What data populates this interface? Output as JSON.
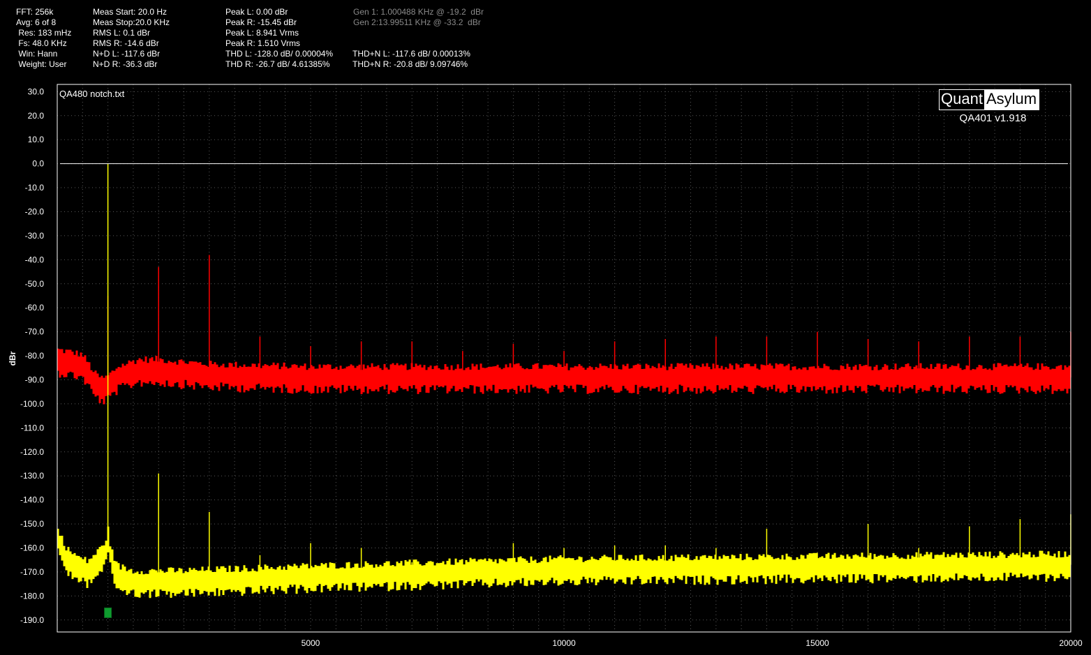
{
  "stats": {
    "col1": [
      "FFT: 256k",
      "Avg: 6 of 8",
      " Res: 183 mHz",
      " Fs: 48.0 KHz",
      " Win: Hann",
      " Weight: User"
    ],
    "col2": [
      "Meas Start: 20.0 Hz",
      "Meas Stop:20.0 KHz",
      "RMS L: 0.1 dBr",
      "RMS R: -14.6 dBr",
      "N+D L: -117.6 dBr",
      "N+D R: -36.3 dBr"
    ],
    "col3": [
      "Peak L: 0.00 dBr",
      "Peak R: -15.45 dBr",
      "Peak L: 8.941 Vrms",
      "Peak R: 1.510 Vrms",
      "THD L: -128.0 dB/ 0.00004%",
      "THD R: -26.7 dB/ 4.61385%"
    ],
    "col4": [
      "",
      "",
      "",
      "",
      "THD+N L: -117.6 dB/ 0.00013%",
      "THD+N R: -20.8 dB/ 9.09746%"
    ],
    "gen": [
      "Gen 1: 1.000488 KHz @ -19.2  dBr",
      "Gen 2:13.99511 KHz @ -33.2  dBr"
    ]
  },
  "logo": {
    "part1": "Quant",
    "part2": "Asylum",
    "version": "QA401 v1.918"
  },
  "colors": {
    "background": "#000000",
    "left_channel": "#ffff00",
    "right_channel": "#ff0000",
    "reference_line": "#ffffff",
    "marker": "#0f9d2f"
  },
  "chart_data": {
    "type": "line",
    "title": "QA480 notch.txt",
    "xlabel": "",
    "ylabel": "dBr",
    "xlim": [
      0,
      20000
    ],
    "ylim": [
      -195,
      33
    ],
    "x_ticks": [
      5000,
      10000,
      15000,
      20000
    ],
    "y_ticks": [
      30.0,
      20.0,
      10.0,
      0.0,
      -10.0,
      -20.0,
      -30.0,
      -40.0,
      -50.0,
      -60.0,
      -70.0,
      -80.0,
      -90.0,
      -100.0,
      -110.0,
      -120.0,
      -130.0,
      -140.0,
      -150.0,
      -160.0,
      -170.0,
      -180.0,
      -190.0
    ],
    "reference_line_db": 0.0,
    "marker_x": 1000,
    "grid": true,
    "series": [
      {
        "color": "#ff0000",
        "floor_db": [
          [
            20,
            -82
          ],
          [
            300,
            -83
          ],
          [
            500,
            -84
          ],
          [
            600,
            -87
          ],
          [
            750,
            -92
          ],
          [
            900,
            -94
          ],
          [
            1000,
            -93
          ],
          [
            1200,
            -89
          ],
          [
            1600,
            -86
          ],
          [
            2000,
            -86
          ],
          [
            3000,
            -88
          ],
          [
            5000,
            -89
          ],
          [
            10000,
            -89
          ],
          [
            15000,
            -89
          ],
          [
            20000,
            -89
          ]
        ],
        "peaks": [
          [
            1000,
            -55
          ],
          [
            2000,
            -43
          ],
          [
            3000,
            -38
          ],
          [
            4000,
            -72
          ],
          [
            5000,
            -76
          ],
          [
            6000,
            -74
          ],
          [
            7000,
            -74
          ],
          [
            8000,
            -78
          ],
          [
            9000,
            -75
          ],
          [
            10000,
            -78
          ],
          [
            11000,
            -74
          ],
          [
            12000,
            -73
          ],
          [
            13000,
            -72
          ],
          [
            14000,
            -72
          ],
          [
            15000,
            -70
          ],
          [
            16000,
            -73
          ],
          [
            17000,
            -74
          ],
          [
            18000,
            -72
          ],
          [
            19000,
            -72
          ],
          [
            20000,
            -70
          ]
        ]
      },
      {
        "color": "#ffff00",
        "floor_db": [
          [
            20,
            -157
          ],
          [
            200,
            -165
          ],
          [
            400,
            -168
          ],
          [
            600,
            -170
          ],
          [
            800,
            -166
          ],
          [
            950,
            -162
          ],
          [
            1000,
            -156
          ],
          [
            1060,
            -165
          ],
          [
            1200,
            -172
          ],
          [
            1500,
            -174
          ],
          [
            2500,
            -174
          ],
          [
            5000,
            -172
          ],
          [
            10000,
            -169
          ],
          [
            15000,
            -168
          ],
          [
            20000,
            -167
          ]
        ],
        "peaks": [
          [
            1000,
            0.0
          ],
          [
            2000,
            -129
          ],
          [
            3000,
            -145
          ],
          [
            4000,
            -163
          ],
          [
            5000,
            -158
          ],
          [
            6000,
            -160
          ],
          [
            7000,
            -166
          ],
          [
            8000,
            -165
          ],
          [
            9000,
            -158
          ],
          [
            10000,
            -160
          ],
          [
            11000,
            -159
          ],
          [
            12000,
            -159
          ],
          [
            13000,
            -160
          ],
          [
            14000,
            -152
          ],
          [
            15000,
            -162
          ],
          [
            16000,
            -150
          ],
          [
            17000,
            -160
          ],
          [
            18000,
            -151
          ],
          [
            19000,
            -148
          ],
          [
            20000,
            -146
          ]
        ]
      }
    ]
  }
}
